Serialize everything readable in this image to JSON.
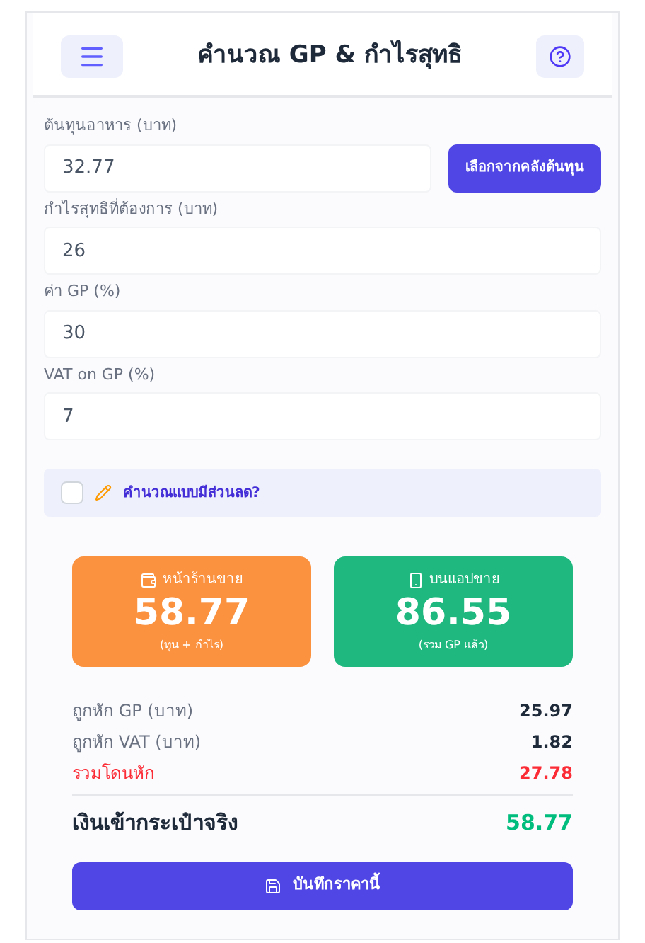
{
  "header": {
    "title": "คำนวณ GP & กำไรสุทธิ"
  },
  "fields": [
    {
      "label": "ต้นทุนอาหาร (บาท)",
      "value": "32.77",
      "button": "เลือกจากคลังต้นทุน"
    },
    {
      "label": "กำไรสุทธิที่ต้องการ (บาท)",
      "value": "26"
    },
    {
      "label": "ค่า GP (%)",
      "value": "30"
    },
    {
      "label": "VAT on GP (%)",
      "value": "7"
    }
  ],
  "discount": {
    "label": "คำนวณแบบมีส่วนลด?",
    "checked": false
  },
  "cards": [
    {
      "title": "หน้าร้านขาย",
      "value": "58.77",
      "note": "(ทุน + กำไร)",
      "color": "#fb9240"
    },
    {
      "title": "บนแอปขาย",
      "value": "86.55",
      "note": "(รวม GP แล้ว)",
      "color": "#1fb97f"
    }
  ],
  "breakdown": [
    {
      "label": "ถูกหัก GP (บาท)",
      "value": "25.97",
      "kind": "normal"
    },
    {
      "label": "ถูกหัก VAT (บาท)",
      "value": "1.82",
      "kind": "normal"
    },
    {
      "label": "รวมโดนหัก",
      "value": "27.78",
      "kind": "deduction"
    },
    {
      "label": "เงินเข้ากระเป๋าจริง",
      "value": "58.77",
      "kind": "total"
    }
  ],
  "save_button": "บันทึกราคานี้"
}
